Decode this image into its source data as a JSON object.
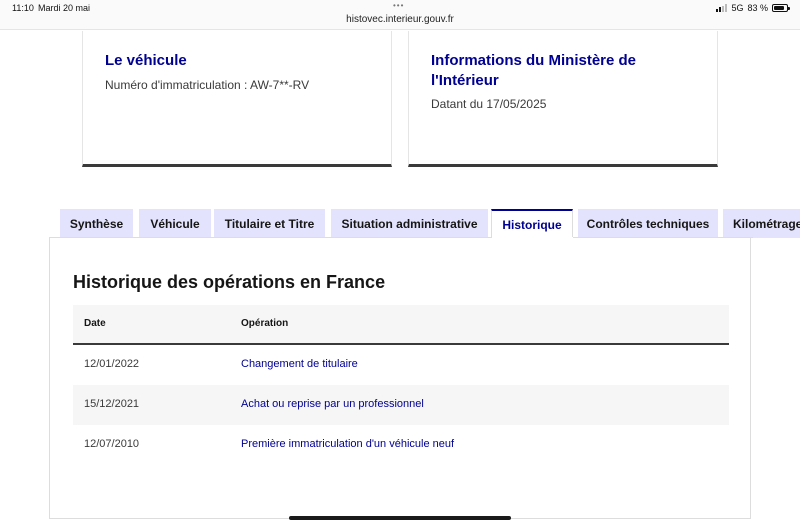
{
  "status_bar": {
    "time": "11:10",
    "date": "Mardi 20 mai",
    "url": "histovec.interieur.gouv.fr",
    "network": "5G",
    "battery": "83 %",
    "battery_level": 0.83
  },
  "cards": [
    {
      "title": "Le véhicule",
      "text": "Numéro d'immatriculation : AW-7**-RV"
    },
    {
      "title": "Informations du Ministère de l'Intérieur",
      "text": "Datant du 17/05/2025"
    }
  ],
  "tabs": [
    {
      "label": "Synthèse"
    },
    {
      "label": "Véhicule"
    },
    {
      "label": "Titulaire et Titre"
    },
    {
      "label": "Situation administrative"
    },
    {
      "label": "Historique"
    },
    {
      "label": "Contrôles techniques"
    },
    {
      "label": "Kilométrage"
    }
  ],
  "active_tab": "Historique",
  "panel": {
    "title": "Historique des opérations en France",
    "columns": {
      "date": "Date",
      "operation": "Opération"
    },
    "rows": [
      {
        "date": "12/01/2022",
        "operation": "Changement de titulaire"
      },
      {
        "date": "15/12/2021",
        "operation": "Achat ou reprise par un professionnel"
      },
      {
        "date": "12/07/2010",
        "operation": "Première immatriculation d'un véhicule neuf"
      }
    ]
  },
  "colors": {
    "accent": "#000091",
    "tab_bg": "#e3e3fd",
    "row_alt": "#f6f6f6"
  }
}
